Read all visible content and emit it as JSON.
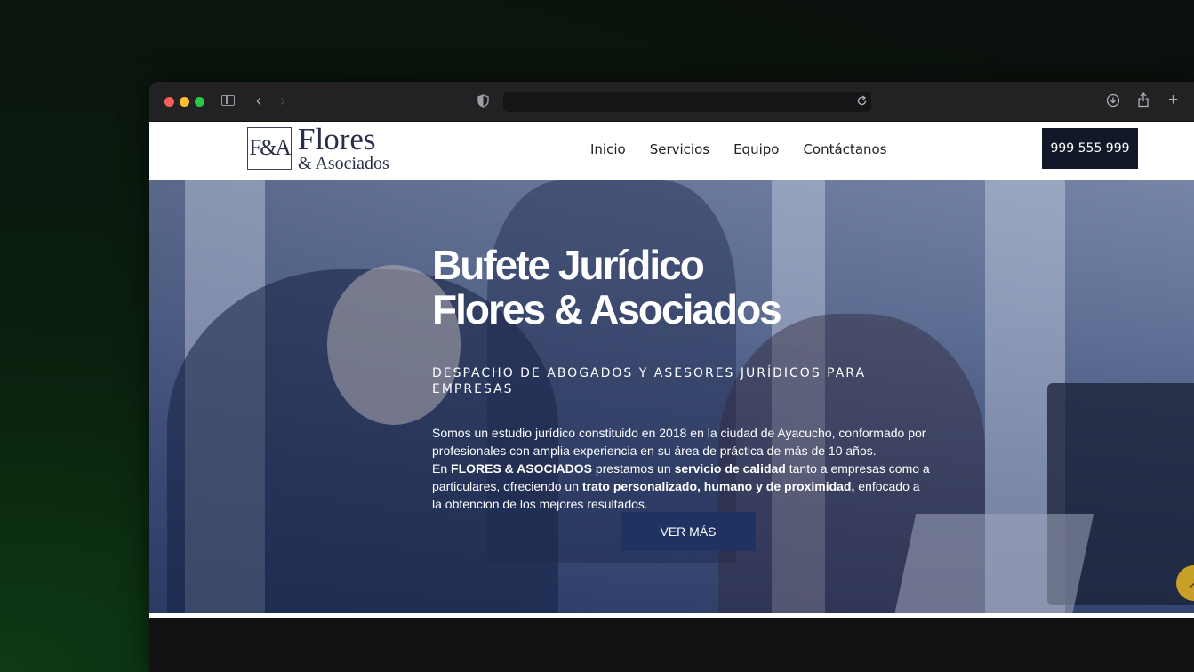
{
  "browser": {
    "url": ""
  },
  "site": {
    "logo": {
      "monogram": "F&A",
      "name": "Flores",
      "sub": "& Asociados"
    },
    "nav": [
      "Inicio",
      "Servicios",
      "Equipo",
      "Contáctanos"
    ],
    "phone": "999 555 999",
    "hero": {
      "title_line1": "Bufete Jurídico",
      "title_line2": "Flores & Asociados",
      "subtitle": "DESPACHO DE ABOGADOS Y ASESORES JURÍDICOS PARA EMPRESAS",
      "paragraph": {
        "p1_a": "Somos un estudio jurídico constituido en 2018 en la ciudad de Ayacucho, conformado por profesionales con amplia experiencia en su área de práctica de más de 10 años.",
        "p2_a": "En ",
        "p2_b": "FLORES & ASOCIADOS",
        "p2_c": " prestamos un ",
        "p2_d": "servicio de calidad",
        "p2_e": " tanto a empresas como a particulares, ofreciendo un ",
        "p2_f": "trato personalizado, humano y de proximidad,",
        "p2_g": " enfocado a la obtencion de los mejores resultados."
      },
      "cta": "VER MÁS"
    }
  },
  "colors": {
    "brand_navy": "#273049",
    "button_dark": "#111827",
    "cta_blue": "#1f3261",
    "accent_gold": "#c8a028"
  },
  "icons": {
    "scroll_top": "arrow-up-icon"
  }
}
